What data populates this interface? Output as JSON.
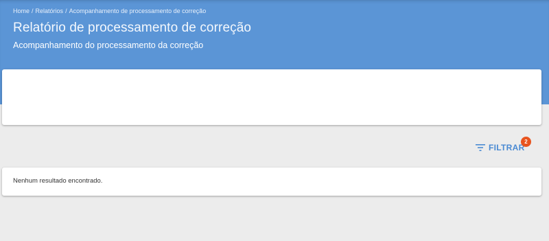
{
  "breadcrumb": {
    "items": [
      "Home",
      "Relatórios",
      "Acompanhamento de processamento de correção"
    ],
    "separator": "/"
  },
  "header": {
    "title": "Relatório de processamento de correção",
    "subtitle": "Acompanhamento do processamento da correção"
  },
  "filter": {
    "label": "FILTRAR",
    "badge_count": "2",
    "icon": "filter-list-icon"
  },
  "results": {
    "empty_message": "Nenhum resultado encontrado."
  },
  "colors": {
    "header_bg": "#5b95d6",
    "accent": "#4a8ad3",
    "badge": "#e8541f",
    "page_bg": "#ececec"
  }
}
